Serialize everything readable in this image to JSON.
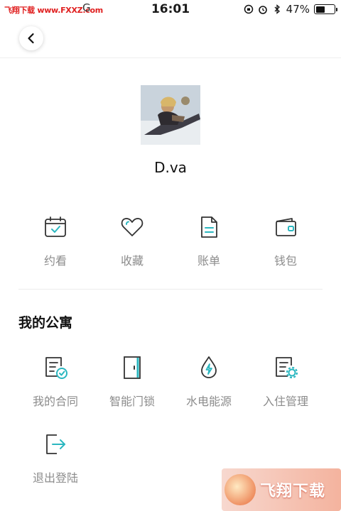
{
  "status_bar": {
    "watermark": "飞翔下载 www.FXXZ.com",
    "carrier": "G",
    "time": "16:01",
    "battery": "47%"
  },
  "profile": {
    "username": "D.va"
  },
  "quick_actions": [
    {
      "label": "约看",
      "icon": "calendar-check-icon"
    },
    {
      "label": "收藏",
      "icon": "heart-icon"
    },
    {
      "label": "账单",
      "icon": "document-icon"
    },
    {
      "label": "钱包",
      "icon": "wallet-icon"
    }
  ],
  "apartment": {
    "title": "我的公寓",
    "items": [
      {
        "label": "我的合同",
        "icon": "contract-check-icon"
      },
      {
        "label": "智能门锁",
        "icon": "door-icon"
      },
      {
        "label": "水电能源",
        "icon": "water-drop-bolt-icon"
      },
      {
        "label": "入住管理",
        "icon": "document-gear-icon"
      },
      {
        "label": "退出登陆",
        "icon": "logout-icon"
      }
    ]
  },
  "watermark_bottom": "飞翔下载",
  "colors": {
    "accent": "#2bb7c0",
    "icon_stroke": "#333333",
    "label": "#8c8c8c"
  }
}
